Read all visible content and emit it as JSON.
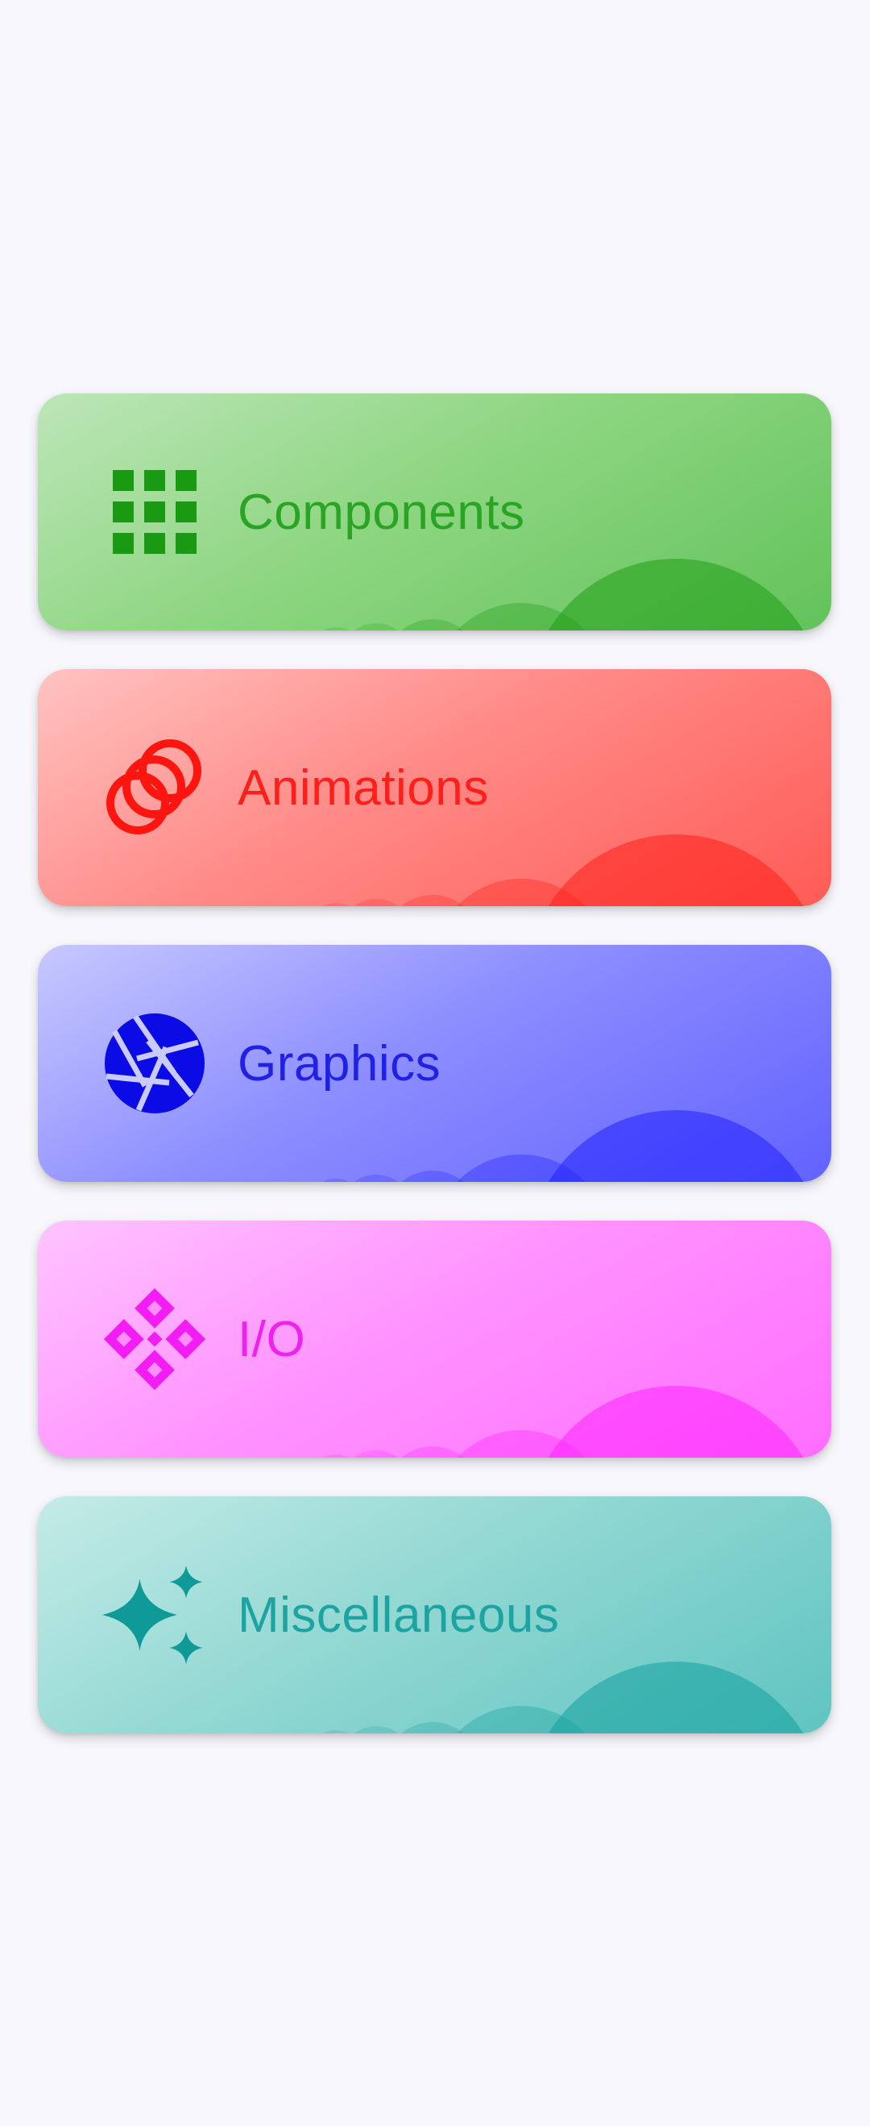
{
  "categories": [
    {
      "id": "components",
      "label": "Components",
      "icon": "grid-icon",
      "color": "#2aa523"
    },
    {
      "id": "animations",
      "label": "Animations",
      "icon": "animation-rings-icon",
      "color": "#ff1f1a"
    },
    {
      "id": "graphics",
      "label": "Graphics",
      "icon": "camera-shutter-icon",
      "color": "#2121e6"
    },
    {
      "id": "io",
      "label": "I/O",
      "icon": "diamond-pattern-icon",
      "color": "#ee22ee"
    },
    {
      "id": "misc",
      "label": "Miscellaneous",
      "icon": "sparkle-icon",
      "color": "#1da4a2"
    }
  ],
  "colors": {
    "background": "#f8f8fc"
  }
}
